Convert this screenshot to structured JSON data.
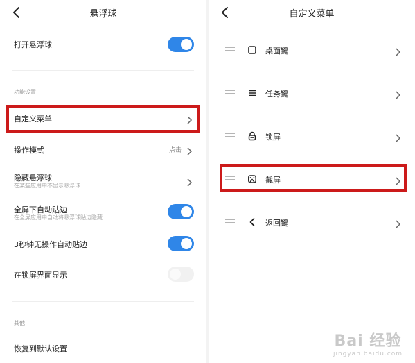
{
  "left": {
    "title": "悬浮球",
    "open_ball": {
      "label": "打开悬浮球",
      "on": true
    },
    "section_feature": "功能设置",
    "custom_menu": {
      "label": "自定义菜单"
    },
    "mode": {
      "label": "操作模式",
      "value": "点击"
    },
    "hide": {
      "label": "隐藏悬浮球",
      "sub": "在某些应用中不显示悬浮球"
    },
    "fullscreen": {
      "label": "全屏下自动贴边",
      "sub": "在全屏应用中自动将悬浮球贴边隐藏",
      "on": true
    },
    "idle": {
      "label": "3秒钟无操作自动贴边",
      "on": true
    },
    "lockscreen": {
      "label": "在锁屏界面显示",
      "on": false
    },
    "section_other": "其他",
    "reset": {
      "label": "恢复到默认设置"
    }
  },
  "right": {
    "title": "自定义菜单",
    "items": [
      {
        "label": "桌面键",
        "icon": "square-icon"
      },
      {
        "label": "任务键",
        "icon": "menu-lines-icon"
      },
      {
        "label": "锁屏",
        "icon": "lock-icon"
      },
      {
        "label": "截屏",
        "icon": "screenshot-icon"
      },
      {
        "label": "返回键",
        "icon": "back-arrow-icon"
      }
    ]
  },
  "watermark": {
    "main": "Bai 经验",
    "sub": "jingyan.baidu.com"
  },
  "colors": {
    "accent": "#2f86e8",
    "highlight": "#cc1a1a"
  }
}
